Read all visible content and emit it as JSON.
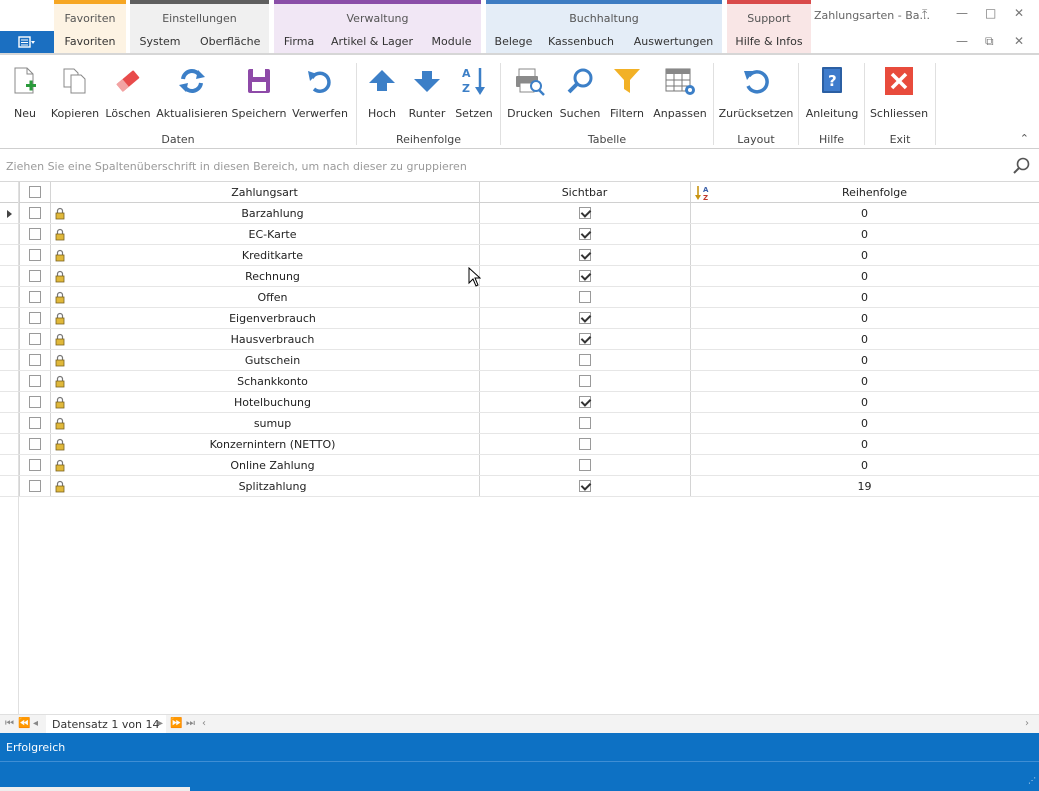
{
  "window": {
    "title": "Zahlungsarten - Ba..."
  },
  "categories": [
    {
      "title": "Favoriten",
      "color": "#f6a623",
      "bg": "#fdf3e3",
      "items": [
        "Favoriten"
      ]
    },
    {
      "title": "Einstellungen",
      "color": "#5f5f5f",
      "bg": "#f0f0f0",
      "items": [
        "System",
        "Oberfläche"
      ]
    },
    {
      "title": "Verwaltung",
      "color": "#8a4ea8",
      "bg": "#f1e7f5",
      "items": [
        "Firma",
        "Artikel & Lager",
        "Module"
      ]
    },
    {
      "title": "Buchhaltung",
      "color": "#3d7cc2",
      "bg": "#e4edf7",
      "items": [
        "Belege",
        "Kassenbuch",
        "Auswertungen"
      ]
    },
    {
      "title": "Support",
      "color": "#d94a4a",
      "bg": "#f9e6e6",
      "items": [
        "Hilfe & Infos"
      ]
    }
  ],
  "ribbon": {
    "buttons": [
      {
        "label": "Neu",
        "icon": "new-document-icon"
      },
      {
        "label": "Kopieren",
        "icon": "copy-icon"
      },
      {
        "label": "Löschen",
        "icon": "eraser-icon"
      },
      {
        "label": "Aktualisieren",
        "icon": "refresh-icon"
      },
      {
        "label": "Speichern",
        "icon": "save-icon"
      },
      {
        "label": "Verwerfen",
        "icon": "undo-icon"
      },
      {
        "label": "Hoch",
        "icon": "arrow-up-icon"
      },
      {
        "label": "Runter",
        "icon": "arrow-down-icon"
      },
      {
        "label": "Setzen",
        "icon": "sort-az-icon"
      },
      {
        "label": "Drucken",
        "icon": "print-preview-icon"
      },
      {
        "label": "Suchen",
        "icon": "search-icon"
      },
      {
        "label": "Filtern",
        "icon": "filter-icon"
      },
      {
        "label": "Anpassen",
        "icon": "customize-grid-icon"
      },
      {
        "label": "Zurücksetzen",
        "icon": "reset-icon"
      },
      {
        "label": "Anleitung",
        "icon": "help-book-icon"
      },
      {
        "label": "Schliessen",
        "icon": "close-icon"
      }
    ],
    "groups": [
      "Daten",
      "Reihenfolge",
      "Tabelle",
      "Layout",
      "Hilfe",
      "Exit"
    ]
  },
  "grouppanel": {
    "hint": "Ziehen Sie eine Spaltenüberschrift in diesen Bereich, um nach dieser zu gruppieren"
  },
  "grid": {
    "columns": {
      "name": "Zahlungsart",
      "visible": "Sichtbar",
      "order": "Reihenfolge"
    },
    "rows": [
      {
        "name": "Barzahlung",
        "visible": true,
        "order": "0"
      },
      {
        "name": "EC-Karte",
        "visible": true,
        "order": "0"
      },
      {
        "name": "Kreditkarte",
        "visible": true,
        "order": "0"
      },
      {
        "name": "Rechnung",
        "visible": true,
        "order": "0"
      },
      {
        "name": "Offen",
        "visible": false,
        "order": "0"
      },
      {
        "name": "Eigenverbrauch",
        "visible": true,
        "order": "0"
      },
      {
        "name": "Hausverbrauch",
        "visible": true,
        "order": "0"
      },
      {
        "name": "Gutschein",
        "visible": false,
        "order": "0"
      },
      {
        "name": "Schankkonto",
        "visible": false,
        "order": "0"
      },
      {
        "name": "Hotelbuchung",
        "visible": true,
        "order": "0"
      },
      {
        "name": "sumup",
        "visible": false,
        "order": "0"
      },
      {
        "name": "Konzernintern (NETTO)",
        "visible": false,
        "order": "0"
      },
      {
        "name": "Online Zahlung",
        "visible": false,
        "order": "0"
      },
      {
        "name": "Splitzahlung",
        "visible": true,
        "order": "19"
      }
    ]
  },
  "navigator": {
    "record": "Datensatz 1 von 14"
  },
  "status": {
    "message": "Erfolgreich"
  }
}
